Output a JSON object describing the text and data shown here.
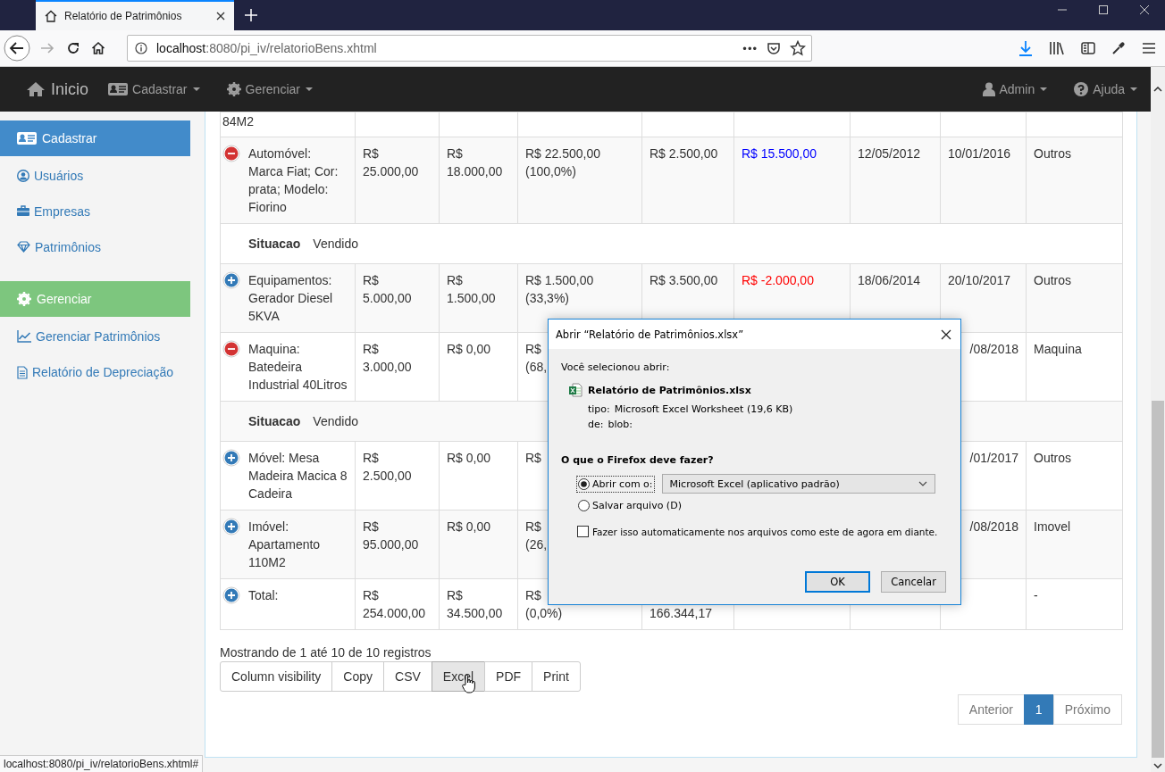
{
  "browser": {
    "tab_title": "Relatório de Patrimônios",
    "url_host": "localhost",
    "url_path": ":8080/pi_iv/relatorioBens.xhtml",
    "page_actions": "•••",
    "status_url": "localhost:8080/pi_iv/relatorioBens.xhtml#"
  },
  "navbar": {
    "brand": "Inicio",
    "left_menus": [
      "Cadastrar",
      "Gerenciar"
    ],
    "right_menus": [
      "Admin",
      "Ajuda"
    ]
  },
  "sidebar": {
    "sections": [
      {
        "title": "Cadastrar",
        "color": "#428bca",
        "items": [
          "Usuários",
          "Empresas",
          "Patrimônios"
        ]
      },
      {
        "title": "Gerenciar",
        "color": "#7dc67e",
        "items": [
          "Gerenciar Patrimônios",
          "Relatório de Depreciação"
        ]
      }
    ]
  },
  "table": {
    "rows": [
      {
        "kind": "cut",
        "cells": [
          {
            "lines": [
              "84M2"
            ]
          },
          null,
          null,
          null,
          null,
          null,
          null,
          null,
          null
        ]
      },
      {
        "kind": "item",
        "expanded": true,
        "cells": [
          {
            "lines": [
              "Automóvel:",
              "Marca Fiat; Cor:",
              "prata; Modelo:",
              "Fiorino"
            ]
          },
          {
            "lines": [
              "R$",
              "25.000,00"
            ]
          },
          {
            "lines": [
              "R$",
              "18.000,00"
            ]
          },
          {
            "lines": [
              "R$ 22.500,00",
              "(100,0%)"
            ]
          },
          {
            "lines": [
              "R$ 2.500,00"
            ]
          },
          {
            "lines": [
              "R$ 15.500,00"
            ],
            "color": "#0000ff"
          },
          {
            "lines": [
              "12/05/2012"
            ]
          },
          {
            "lines": [
              "10/01/2016"
            ]
          },
          {
            "lines": [
              "Outros"
            ]
          }
        ]
      },
      {
        "kind": "detail",
        "label": "Situacao",
        "value": "Vendido"
      },
      {
        "kind": "item",
        "expanded": false,
        "cells": [
          {
            "lines": [
              "Equipamentos:",
              "Gerador Diesel",
              "5KVA"
            ]
          },
          {
            "lines": [
              "R$",
              "5.000,00"
            ]
          },
          {
            "lines": [
              "R$",
              "1.500,00"
            ]
          },
          {
            "lines": [
              "R$ 1.500,00",
              "(33,3%)"
            ]
          },
          {
            "lines": [
              "R$ 3.500,00"
            ]
          },
          {
            "lines": [
              "R$ -2.000,00"
            ],
            "color": "#ff0000"
          },
          {
            "lines": [
              "18/06/2014"
            ]
          },
          {
            "lines": [
              "20/10/2017"
            ]
          },
          {
            "lines": [
              "Outros"
            ]
          }
        ]
      },
      {
        "kind": "item",
        "expanded": true,
        "cells": [
          {
            "lines": [
              "Maquina:",
              "Batedeira",
              "Industrial 40Litros"
            ]
          },
          {
            "lines": [
              "R$",
              "3.000,00"
            ]
          },
          {
            "lines": [
              "R$ 0,00"
            ]
          },
          {
            "lines": [
              "R$",
              "(68,"
            ]
          },
          null,
          null,
          null,
          {
            "lines": [
              "/08/2018"
            ],
            "clipped_left": true
          },
          {
            "lines": [
              "Maquina"
            ]
          }
        ]
      },
      {
        "kind": "detail",
        "label": "Situacao",
        "value": "Vendido"
      },
      {
        "kind": "item",
        "expanded": false,
        "cells": [
          {
            "lines": [
              "Móvel: Mesa",
              "Madeira Macica 8",
              "Cadeira"
            ]
          },
          {
            "lines": [
              "R$",
              "2.500,00"
            ]
          },
          {
            "lines": [
              "R$ 0,00"
            ]
          },
          {
            "lines": [
              "R$"
            ]
          },
          null,
          null,
          null,
          {
            "lines": [
              "/01/2017"
            ],
            "clipped_left": true
          },
          {
            "lines": [
              "Outros"
            ]
          }
        ]
      },
      {
        "kind": "item",
        "expanded": false,
        "cells": [
          {
            "lines": [
              "Imóvel:",
              "Apartamento",
              "110M2"
            ]
          },
          {
            "lines": [
              "R$",
              "95.000,00"
            ]
          },
          {
            "lines": [
              "R$ 0,00"
            ]
          },
          {
            "lines": [
              "R$",
              "(26,"
            ]
          },
          null,
          null,
          null,
          {
            "lines": [
              "/08/2018"
            ],
            "clipped_left": true
          },
          {
            "lines": [
              "Imovel"
            ]
          }
        ]
      },
      {
        "kind": "item",
        "expanded": false,
        "cells": [
          {
            "lines": [
              "Total:"
            ]
          },
          {
            "lines": [
              "R$",
              "254.000,00"
            ]
          },
          {
            "lines": [
              "R$",
              "34.500,00"
            ]
          },
          {
            "lines": [
              "R$",
              "(0,0%)"
            ]
          },
          {
            "lines": [
              "166.344,17"
            ],
            "clipped_top": true
          },
          null,
          null,
          null,
          {
            "lines": [
              "-"
            ]
          }
        ]
      }
    ]
  },
  "footer": {
    "info": "Mostrando de 1 até 10 de 10 registros",
    "export_buttons": [
      {
        "label": "Column visibility",
        "selected": false
      },
      {
        "label": "Copy",
        "selected": false
      },
      {
        "label": "CSV",
        "selected": false
      },
      {
        "label": "Excel",
        "selected": true
      },
      {
        "label": "PDF",
        "selected": false
      },
      {
        "label": "Print",
        "selected": false
      }
    ],
    "pagination": [
      {
        "label": "Anterior",
        "selected": false
      },
      {
        "label": "1",
        "selected": true
      },
      {
        "label": "Próximo",
        "selected": false
      }
    ]
  },
  "dialog": {
    "title": "Abrir “Relatório de Patrimônios.xlsx”",
    "intro": "Você selecionou abrir:",
    "file_name": "Relatório de Patrimônios.xlsx",
    "details": [
      {
        "label": "tipo:",
        "value": "Microsoft Excel Worksheet (19,6 KB)"
      },
      {
        "label": "de:",
        "value": "blob:"
      }
    ],
    "question": "O que o Firefox deve fazer?",
    "options": [
      {
        "label": "Abrir com o:",
        "selected": true
      },
      {
        "label": "Salvar arquivo (D)",
        "selected": false
      }
    ],
    "app_select": "Microsoft Excel (aplicativo padrão)",
    "remember": {
      "label": "Fazer isso automaticamente nos arquivos como este de agora em diante.",
      "checked": false
    },
    "buttons": [
      {
        "label": "OK",
        "selected": true
      },
      {
        "label": "Cancelar",
        "selected": false
      }
    ]
  }
}
